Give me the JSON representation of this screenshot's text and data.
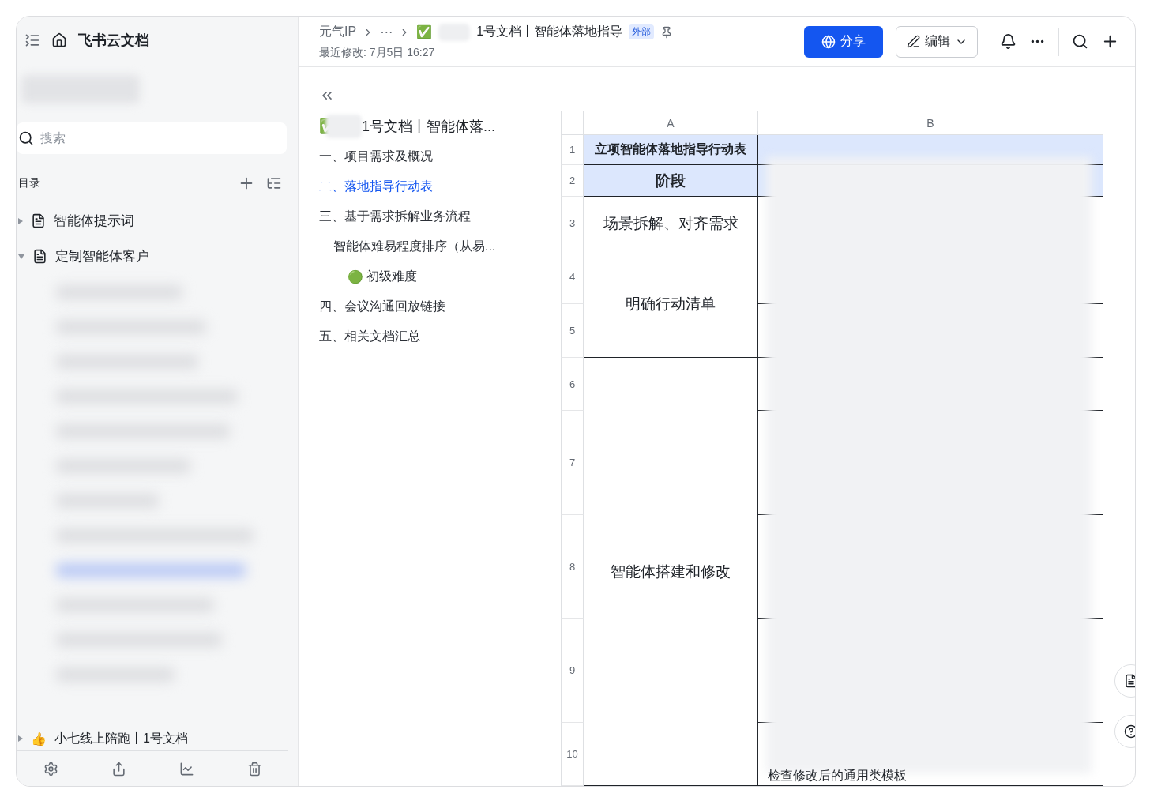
{
  "sidebar": {
    "title": "飞书云文档",
    "search": {
      "placeholder": "搜索"
    },
    "section_label": "目录",
    "tree": [
      {
        "label": "智能体提示词",
        "expanded": false
      },
      {
        "label": "定制智能体客户",
        "expanded": true
      }
    ],
    "bottom_item": {
      "emoji": "👍",
      "label": "小七线上陪跑丨1号文档",
      "expanded": false
    }
  },
  "header": {
    "breadcrumb": [
      "元气IP",
      "⋯"
    ],
    "title_emoji": "✅",
    "title": "1号文档丨智能体落地指导",
    "tag": "外部",
    "modified": "最近修改: 7月5日 16:27",
    "share": "分享",
    "edit": "编辑"
  },
  "outline": {
    "title": "1号文档丨智能体落...",
    "title_emoji": "✅",
    "items": [
      {
        "label": "一、项目需求及概况",
        "selected": false
      },
      {
        "label": "二、落地指导行动表",
        "selected": true
      },
      {
        "label": "三、基于需求拆解业务流程",
        "selected": false,
        "children": [
          {
            "label": "智能体难易程度排序（从易...",
            "selected": false,
            "children": [
              {
                "label": "初级难度",
                "emoji": "🟢",
                "selected": false
              }
            ]
          }
        ]
      },
      {
        "label": "四、会议沟通回放链接",
        "selected": false
      },
      {
        "label": "五、相关文档汇总",
        "selected": false
      }
    ]
  },
  "sheet": {
    "columns": [
      "A",
      "B"
    ],
    "rows": [
      {
        "num": "1",
        "a": "立项智能体落地指导行动表",
        "header": true
      },
      {
        "num": "2",
        "a": "阶段",
        "header": true
      },
      {
        "num": "3",
        "a": "场景拆解、对齐需求",
        "header": false
      },
      {
        "num": "4",
        "a": "明确行动清单",
        "header": false
      },
      {
        "num": "5"
      },
      {
        "num": "6",
        "a": "智能体搭建和修改",
        "header": false
      },
      {
        "num": "7"
      },
      {
        "num": "8"
      },
      {
        "num": "9"
      },
      {
        "num": "10"
      }
    ],
    "bottom_text": "检查修改后的通用类模板"
  }
}
